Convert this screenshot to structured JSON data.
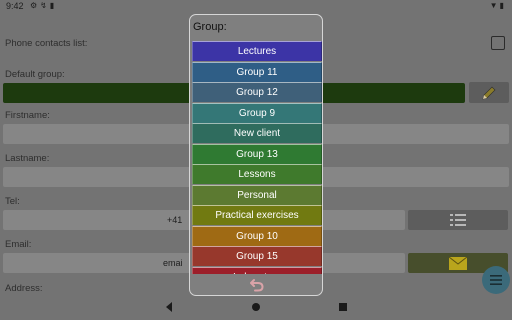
{
  "status_bar": {
    "time": "9:42",
    "left_icons": [
      "gear-icon",
      "sync-icon",
      "sd-card-icon"
    ],
    "right_icons": [
      "wifi-icon",
      "battery-icon"
    ]
  },
  "form": {
    "phone_contacts_label": "Phone contacts list:",
    "default_group_label": "Default group:",
    "firstname_label": "Firstname:",
    "lastname_label": "Lastname:",
    "tel_label": "Tel:",
    "tel_value_partial": "+41",
    "email_label": "Email:",
    "email_value_partial": "emai",
    "address_label": "Address:"
  },
  "dialog": {
    "title": "Group:",
    "items": [
      {
        "label": "Lectures",
        "color": "#3c34a6"
      },
      {
        "label": "Group 11",
        "color": "#2f5e86"
      },
      {
        "label": "Group 12",
        "color": "#3f6079"
      },
      {
        "label": "Group 9",
        "color": "#347777"
      },
      {
        "label": "New client",
        "color": "#2f6c5e"
      },
      {
        "label": "Group 13",
        "color": "#2f7a32"
      },
      {
        "label": "Lessons",
        "color": "#3f7a2c"
      },
      {
        "label": "Personal",
        "color": "#5c7a31"
      },
      {
        "label": "Practical exercises",
        "color": "#717a11"
      },
      {
        "label": "Group 10",
        "color": "#9f6a14"
      },
      {
        "label": "Group 15",
        "color": "#97382c"
      },
      {
        "label": "Laboratory",
        "color": "#9c1f2a"
      }
    ],
    "undo_icon": "undo-icon",
    "undo_color": "#d9a3a8"
  },
  "nav": {
    "back": "back-icon",
    "home": "home-icon",
    "recents": "recents-icon"
  }
}
